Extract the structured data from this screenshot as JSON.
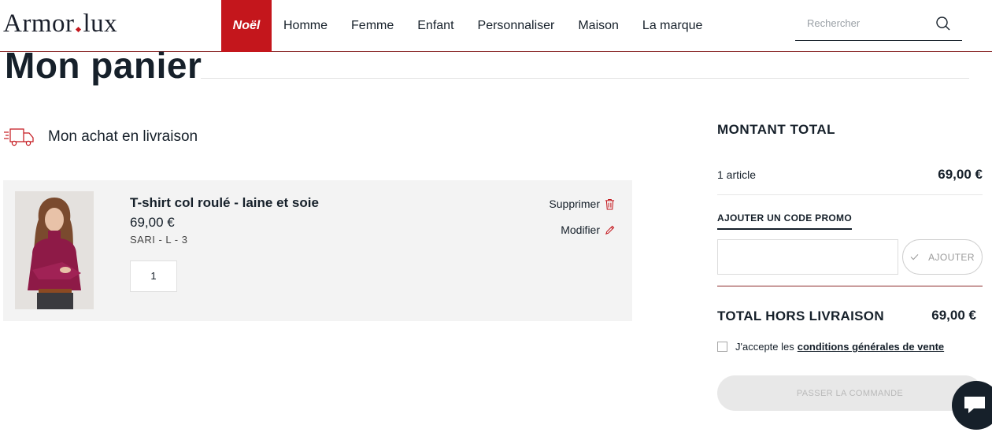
{
  "header": {
    "logo_left": "Armor",
    "logo_right": "lux",
    "nav": [
      "Noël",
      "Homme",
      "Femme",
      "Enfant",
      "Personnaliser",
      "Maison",
      "La marque"
    ],
    "search_placeholder": "Rechercher"
  },
  "page": {
    "title": "Mon panier",
    "delivery_heading": "Mon achat en livraison"
  },
  "cart": {
    "items": [
      {
        "name": "T-shirt col roulé - laine et soie",
        "price": "69,00 €",
        "variant": "SARI - L - 3",
        "quantity": "1",
        "delete_label": "Supprimer",
        "edit_label": "Modifier"
      }
    ]
  },
  "summary": {
    "title": "MONTANT TOTAL",
    "articles_label": "1 article",
    "articles_value": "69,00 €",
    "promo_tab": "AJOUTER UN CODE PROMO",
    "promo_value": "",
    "promo_button": "AJOUTER",
    "total_label": "TOTAL HORS LIVRAISON",
    "total_value": "69,00 €",
    "cgv_prefix": "J'accepte les",
    "cgv_link": "conditions générales de vente",
    "order_button": "PASSER LA COMMANDE"
  },
  "colors": {
    "accent": "#c4161c",
    "text": "#16202a",
    "panel": "#f3f3f3"
  }
}
